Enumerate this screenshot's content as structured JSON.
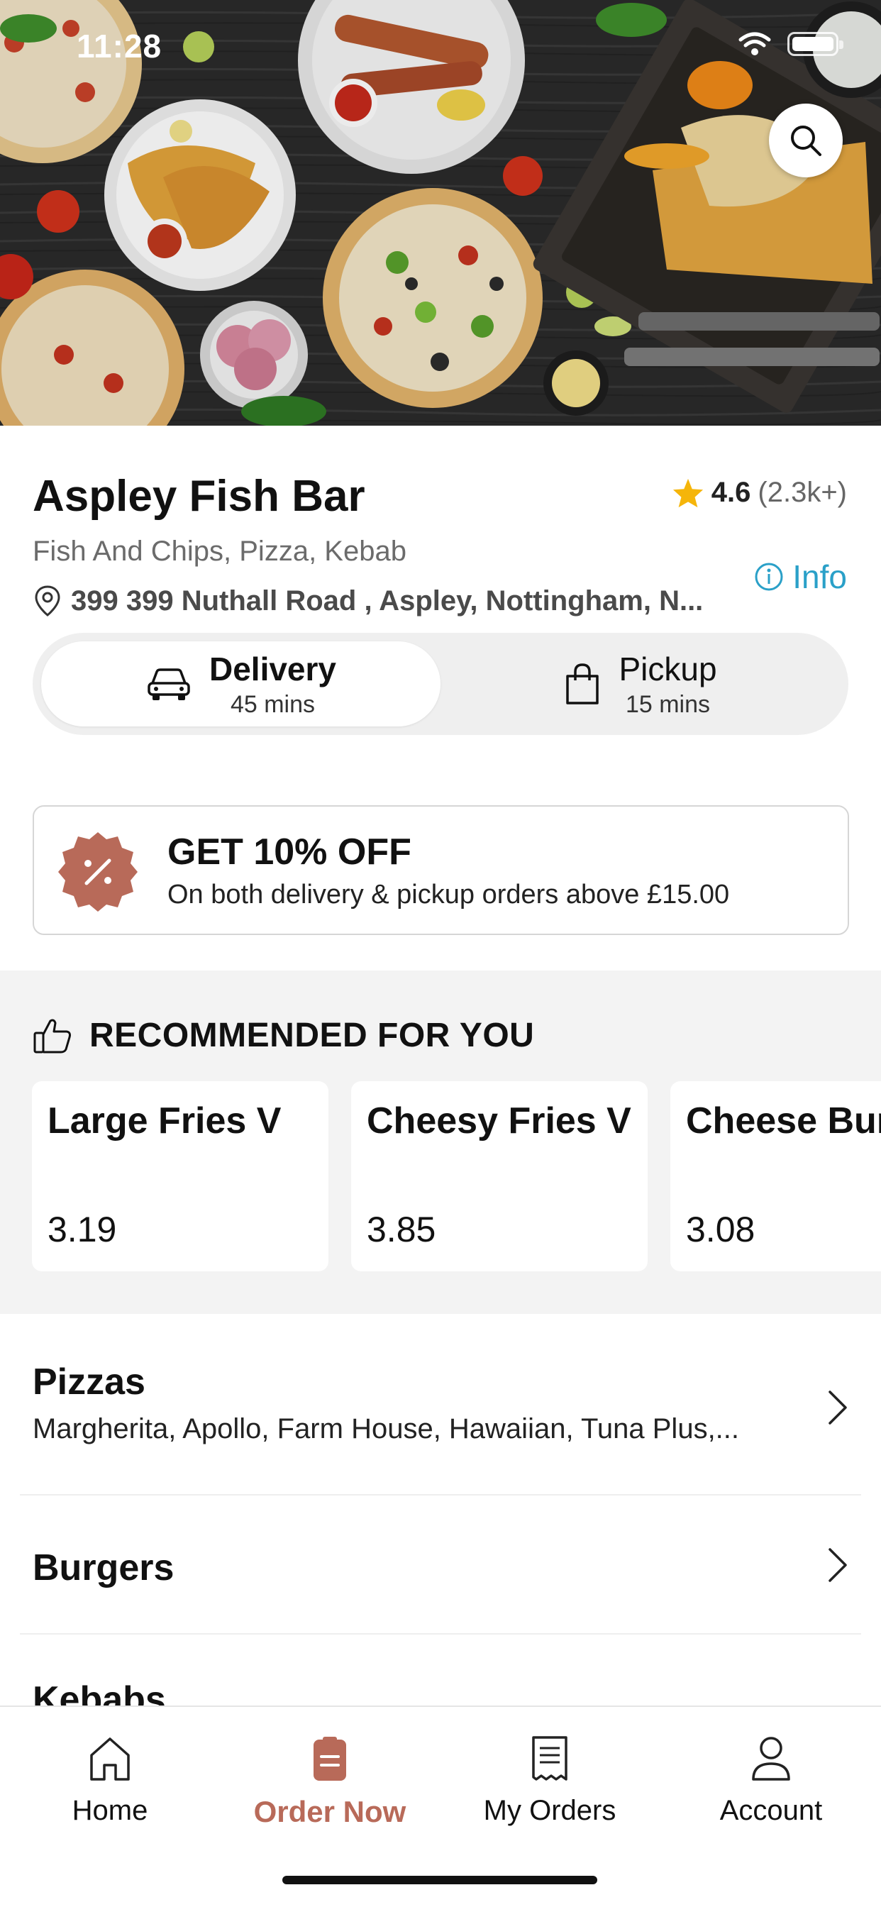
{
  "status_bar": {
    "time": "11:28"
  },
  "restaurant": {
    "name": "Aspley Fish Bar",
    "rating": "4.6",
    "rating_count": "(2.3k+)",
    "cuisine": "Fish And Chips, Pizza, Kebab",
    "address": "399 399 Nuthall Road , Aspley, Nottingham, N...",
    "info_label": "Info"
  },
  "modes": {
    "delivery": {
      "label": "Delivery",
      "time": "45 mins",
      "selected": true
    },
    "pickup": {
      "label": "Pickup",
      "time": "15 mins",
      "selected": false
    }
  },
  "promo": {
    "title": "GET 10% OFF",
    "subtitle": "On both delivery & pickup orders above £15.00"
  },
  "recommended": {
    "title": "RECOMMENDED FOR YOU",
    "items": [
      {
        "name": "Large Fries V",
        "price": "3.19"
      },
      {
        "name": "Cheesy Fries V",
        "price": "3.85"
      },
      {
        "name": "Cheese Burger",
        "price": "3.08"
      }
    ]
  },
  "categories": [
    {
      "name": "Pizzas",
      "items": "Margherita, Apollo, Farm House, Hawaiian, Tuna Plus,..."
    },
    {
      "name": "Burgers",
      "items": ""
    },
    {
      "name": "Kebabs",
      "items": ""
    }
  ],
  "tabbar": {
    "tabs": [
      {
        "label": "Home",
        "icon": "home-icon"
      },
      {
        "label": "Order Now",
        "icon": "order-icon",
        "active": true
      },
      {
        "label": "My Orders",
        "icon": "receipt-icon"
      },
      {
        "label": "Account",
        "icon": "user-icon"
      }
    ]
  },
  "colors": {
    "accent": "#b86a59",
    "info": "#2aa0c8",
    "star": "#f5b50a"
  }
}
